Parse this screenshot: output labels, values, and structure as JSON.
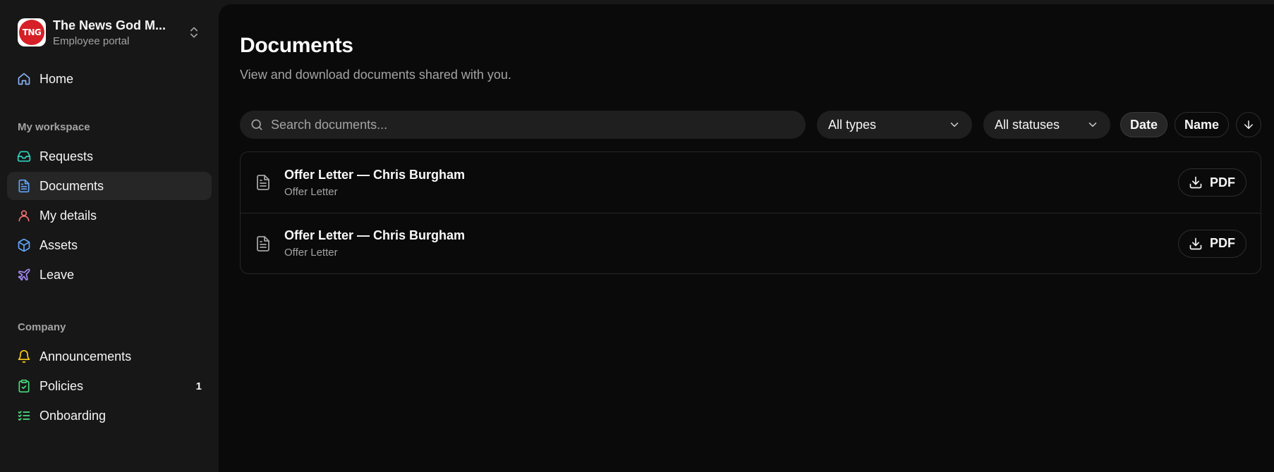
{
  "org": {
    "logo_text": "TNG",
    "name": "The News God M...",
    "subtitle": "Employee portal"
  },
  "sidebar": {
    "home": {
      "label": "Home",
      "icon": "home-icon"
    },
    "workspace_title": "My workspace",
    "workspace_items": [
      {
        "label": "Requests",
        "icon": "inbox-icon",
        "color": "#2dd4bf"
      },
      {
        "label": "Documents",
        "icon": "file-text-icon",
        "color": "#60a5fa",
        "active": true
      },
      {
        "label": "My details",
        "icon": "user-icon",
        "color": "#f87171"
      },
      {
        "label": "Assets",
        "icon": "box-icon",
        "color": "#60a5fa"
      },
      {
        "label": "Leave",
        "icon": "plane-icon",
        "color": "#a78bfa"
      }
    ],
    "company_title": "Company",
    "company_items": [
      {
        "label": "Announcements",
        "icon": "bell-icon",
        "color": "#facc15"
      },
      {
        "label": "Policies",
        "icon": "clipboard-check-icon",
        "color": "#4ade80",
        "badge": "1"
      },
      {
        "label": "Onboarding",
        "icon": "list-checks-icon",
        "color": "#4ade80"
      }
    ]
  },
  "main": {
    "title": "Documents",
    "subtitle": "View and download documents shared with you.",
    "search_placeholder": "Search documents...",
    "type_filter": "All types",
    "status_filter": "All statuses",
    "sort_date": "Date",
    "sort_name": "Name",
    "documents": [
      {
        "title": "Offer Letter — Chris Burgham",
        "type": "Offer Letter",
        "action": "PDF"
      },
      {
        "title": "Offer Letter — Chris Burgham",
        "type": "Offer Letter",
        "action": "PDF"
      }
    ]
  }
}
